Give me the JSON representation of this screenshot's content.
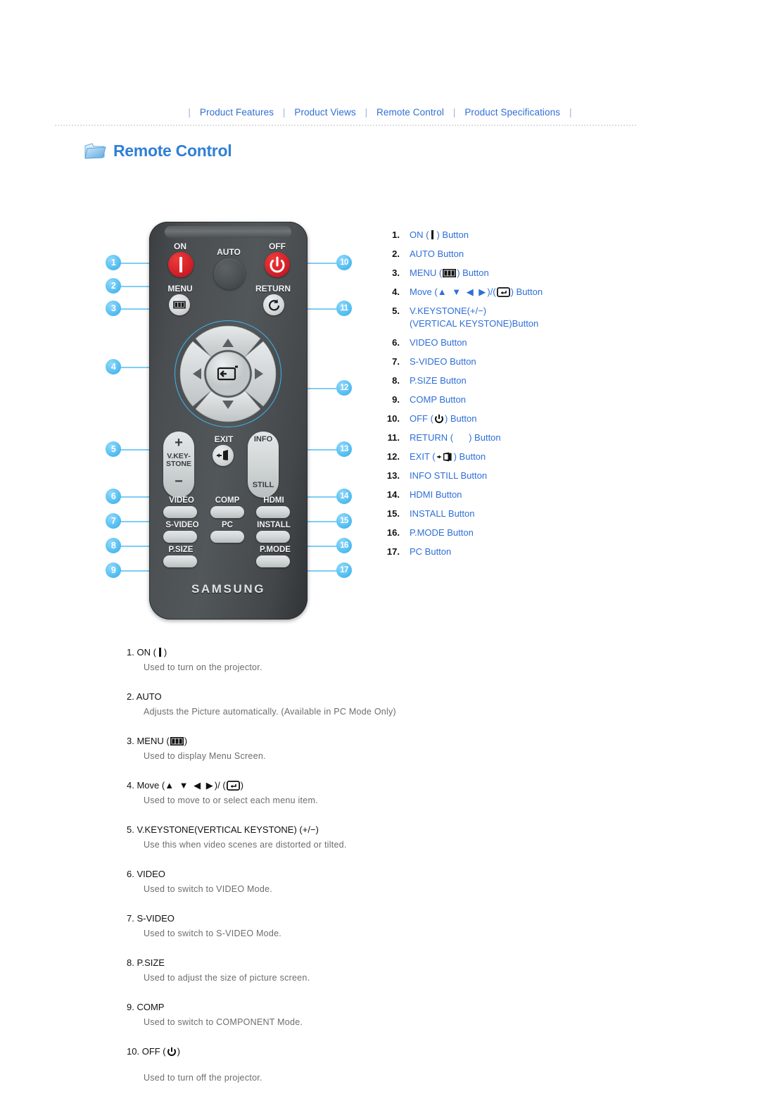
{
  "nav": {
    "separator": "|",
    "items": [
      {
        "label": "Product Features"
      },
      {
        "label": "Product Views"
      },
      {
        "label": "Remote Control"
      },
      {
        "label": "Product Specifications"
      }
    ]
  },
  "header": {
    "title": "Remote Control",
    "icon": "folder-icon",
    "accent_color": "#2f7fd6"
  },
  "remote": {
    "brand": "SAMSUNG",
    "labels": {
      "on": "ON",
      "auto": "AUTO",
      "off": "OFF",
      "menu": "MENU",
      "return": "RETURN",
      "vkeystone_line1": "V.KEY-",
      "vkeystone_line2": "STONE",
      "vkeystone_plus": "+",
      "vkeystone_minus": "−",
      "exit": "EXIT",
      "info": "INFO",
      "still": "STILL",
      "video": "VIDEO",
      "comp": "COMP",
      "hdmi": "HDMI",
      "svideo": "S-VIDEO",
      "pc": "PC",
      "install": "INSTALL",
      "psize": "P.SIZE",
      "pmode": "P.MODE"
    },
    "callout_numbers": [
      "1",
      "2",
      "3",
      "4",
      "5",
      "6",
      "7",
      "8",
      "9",
      "10",
      "11",
      "12",
      "13",
      "14",
      "15",
      "16",
      "17"
    ],
    "callout_badge_color": "#57bff2"
  },
  "button_list": {
    "items": [
      {
        "num": "1.",
        "text_before": "ON (",
        "icon": "power-on-bar-icon",
        "text_after": ") Button"
      },
      {
        "num": "2.",
        "text": "AUTO Button"
      },
      {
        "num": "3.",
        "text_before": "MENU (",
        "icon": "menu-icon",
        "text_after": ") Button"
      },
      {
        "num": "4.",
        "text_before": "Move (",
        "arrows": "▲ ▼ ◀ ▶",
        "mid": ")/(",
        "icon": "enter-icon",
        "text_after": ") Button"
      },
      {
        "num": "5.",
        "text": "V.KEYSTONE(+/−)",
        "text2": "(VERTICAL KEYSTONE)Button"
      },
      {
        "num": "6.",
        "text": "VIDEO Button"
      },
      {
        "num": "7.",
        "text": "S-VIDEO Button"
      },
      {
        "num": "8.",
        "text": "P.SIZE Button"
      },
      {
        "num": "9.",
        "text": "COMP Button"
      },
      {
        "num": "10.",
        "text_before": "OFF (",
        "icon": "power-off-icon",
        "text_after": ") Button"
      },
      {
        "num": "11.",
        "text_before": "RETURN (",
        "icon": "blank-icon",
        "text_after": ") Button"
      },
      {
        "num": "12.",
        "text_before": "EXIT (",
        "icon": "exit-icon",
        "text_after": ") Button"
      },
      {
        "num": "13.",
        "text": "INFO STILL Button"
      },
      {
        "num": "14.",
        "text": "HDMI Button"
      },
      {
        "num": "15.",
        "text": "INSTALL Button"
      },
      {
        "num": "16.",
        "text": "P.MODE Button"
      },
      {
        "num": "17.",
        "text": "PC Button"
      }
    ],
    "link_color": "#2f6fd8"
  },
  "descriptions": {
    "items": [
      {
        "num": "1.",
        "title_before": "ON (",
        "icon": "power-on-bar-icon",
        "title_after": ")",
        "body": "Used to turn on the projector."
      },
      {
        "num": "2.",
        "title": "AUTO",
        "body": "Adjusts the Picture automatically. (Available in PC Mode Only)"
      },
      {
        "num": "3.",
        "title_before": "MENU (",
        "icon": "menu-icon",
        "title_after": ")",
        "body": "Used to display Menu Screen."
      },
      {
        "num": "4.",
        "title_before": "Move (",
        "arrows": "▲ ▼ ◀ ▶",
        "mid": ")/ (",
        "icon": "enter-icon",
        "title_after": ")",
        "body": "Used to move to or select each menu item."
      },
      {
        "num": "5.",
        "title": "V.KEYSTONE(VERTICAL KEYSTONE) (+/−)",
        "body": "Use this when video scenes are distorted or tilted."
      },
      {
        "num": "6.",
        "title": "VIDEO",
        "body": "Used to switch to VIDEO Mode."
      },
      {
        "num": "7.",
        "title": "S-VIDEO",
        "body": "Used to switch to S-VIDEO Mode."
      },
      {
        "num": "8.",
        "title": "P.SIZE",
        "body": "Used to adjust the size of picture screen."
      },
      {
        "num": "9.",
        "title": "COMP",
        "body": "Used to switch to COMPONENT Mode."
      },
      {
        "num": "10.",
        "title_before": "OFF (",
        "icon": "power-off-icon",
        "title_after": ")",
        "body": "Used to turn off the projector."
      }
    ]
  }
}
